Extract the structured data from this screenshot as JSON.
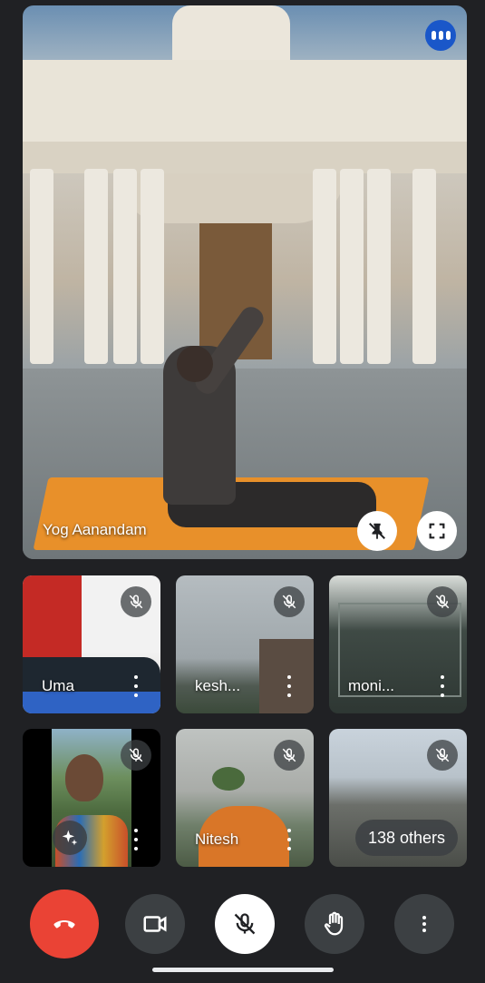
{
  "main_tile": {
    "name": "Yog Aanandam",
    "icons": {
      "menu": "audio-levels-icon",
      "pin": "unpin-icon",
      "fullscreen": "fullscreen-icon"
    }
  },
  "tiles": [
    {
      "name": "Uma",
      "mic": "mic-off-icon"
    },
    {
      "name": "kesh...",
      "mic": "mic-off-icon"
    },
    {
      "name": "moni...",
      "mic": "mic-off-icon"
    },
    {
      "name": "",
      "mic": "mic-off-icon",
      "effects": "sparkle-effects-icon"
    },
    {
      "name": "Nitesh",
      "mic": "mic-off-icon"
    },
    {
      "name": "",
      "mic": "mic-off-icon",
      "others": "138 others"
    }
  ],
  "controls": [
    {
      "name": "end-call",
      "icon": "phone-hangup-icon",
      "color": "#ea4335"
    },
    {
      "name": "camera",
      "icon": "video-camera-icon",
      "color": "#3c4043"
    },
    {
      "name": "microphone",
      "icon": "mic-off-icon",
      "color": "#ffffff"
    },
    {
      "name": "raise-hand",
      "icon": "hand-icon",
      "color": "#3c4043"
    },
    {
      "name": "more-options",
      "icon": "more-vert-icon",
      "color": "#3c4043"
    }
  ],
  "colors": {
    "background": "#202124",
    "accent": "#1a57c9",
    "end_call": "#ea4335"
  }
}
